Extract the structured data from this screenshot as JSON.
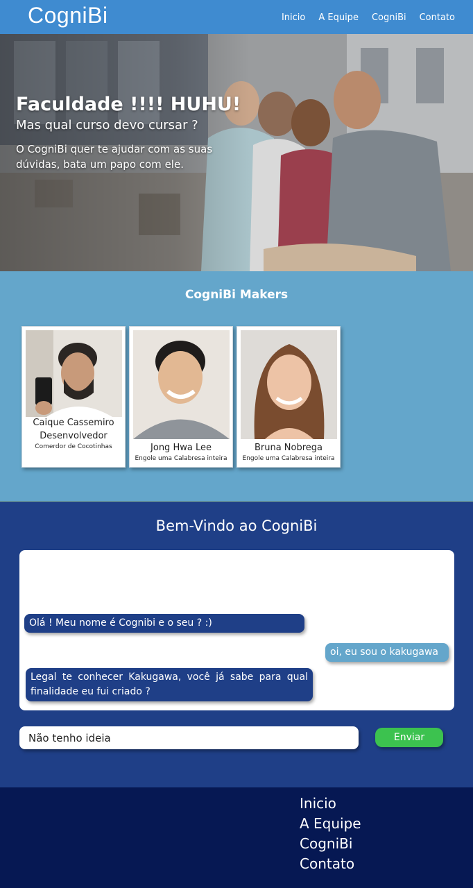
{
  "nav": {
    "brand": "CogniBi",
    "links": [
      "Inicio",
      "A Equipe",
      "CogniBi",
      "Contato"
    ]
  },
  "hero": {
    "title": "Faculdade !!!! HUHU!",
    "subtitle": "Mas qual curso devo cursar ?",
    "text": "O CogniBi quer te ajudar com as suas dúvidas, bata um papo com ele."
  },
  "makers": {
    "title": "CogniBi Makers",
    "cards": [
      {
        "name": "Caique Cassemiro",
        "role": "Desenvolvedor",
        "tag": "Comerdor de Cocotinhas"
      },
      {
        "name": "Jong Hwa Lee",
        "role": "",
        "tag": "Engole uma Calabresa inteira"
      },
      {
        "name": "Bruna Nobrega",
        "role": "",
        "tag": "Engole uma Calabresa inteira"
      }
    ]
  },
  "chat": {
    "title": "Bem-Vindo ao CogniBi",
    "messages": [
      {
        "from": "bot",
        "text": "Olá ! Meu nome é Cognibi e o seu ? :)"
      },
      {
        "from": "user",
        "text": "oi, eu sou o kakugawa"
      },
      {
        "from": "bot",
        "text": "Legal te conhecer Kakugawa, você já sabe para qual finalidade eu fui criado ?"
      }
    ],
    "input_value": "Não tenho ideia",
    "send_label": "Enviar"
  },
  "footer": {
    "links": [
      "Inicio",
      "A Equipe",
      "CogniBi",
      "Contato"
    ]
  },
  "colors": {
    "nav": "#3f8bd0",
    "makers_bg": "#64a6cb",
    "chat_bg": "#1f3f87",
    "footer_bg": "#061853",
    "send_button": "#3cc24f"
  }
}
